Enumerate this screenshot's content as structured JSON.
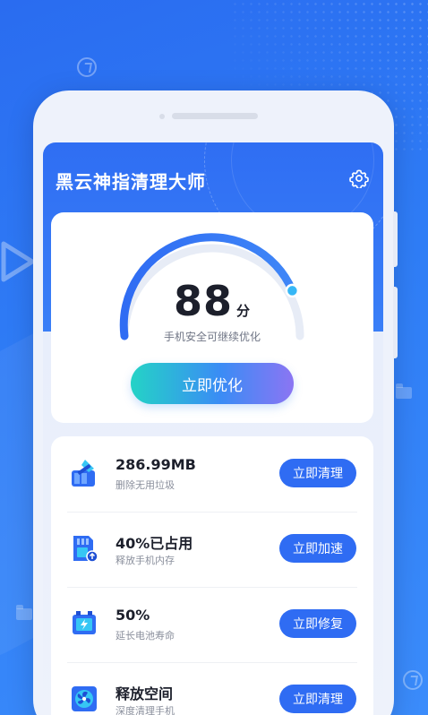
{
  "app": {
    "title": "黑云神指清理大师",
    "settings_icon": "gear-icon"
  },
  "score": {
    "value": "88",
    "unit": "分",
    "subtitle": "手机安全可继续优化",
    "progress_percent": 88,
    "optimize_label": "立即优化"
  },
  "items": [
    {
      "title": "286.99MB",
      "subtitle": "删除无用垃圾",
      "button": "立即清理",
      "icon": "broom-icon"
    },
    {
      "title": "40%已占用",
      "subtitle": "释放手机内存",
      "button": "立即加速",
      "icon": "memory-card-icon"
    },
    {
      "title": "50%",
      "subtitle": "延长电池寿命",
      "button": "立即修复",
      "icon": "battery-icon"
    },
    {
      "title": "释放空间",
      "subtitle": "深度清理手机",
      "button": "立即清理",
      "icon": "fan-icon"
    }
  ],
  "colors": {
    "primary": "#2f6cf3",
    "background": "#2f7df6",
    "gradient_start": "#24d3c6",
    "gradient_end": "#8b75f3"
  }
}
